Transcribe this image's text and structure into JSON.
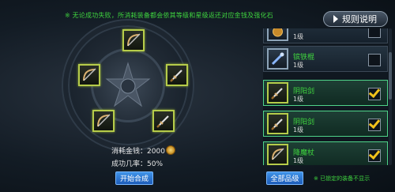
{
  "notice": "※ 无论成功失败，所消耗装备都会依其等级和星级返还对应金钱及强化石",
  "rules_button": {
    "label": "规则说明",
    "icon": "play-arrow-icon"
  },
  "wheel": {
    "slots": [
      {
        "name": "top",
        "icon": "bow-icon"
      },
      {
        "name": "upper-left",
        "icon": "bow-icon"
      },
      {
        "name": "upper-right",
        "icon": "sword-icon"
      },
      {
        "name": "lower-left",
        "icon": "bow-icon"
      },
      {
        "name": "lower-right",
        "icon": "sword-icon"
      }
    ]
  },
  "cost": {
    "label": "消耗金钱：",
    "value": "2000",
    "icon": "gold-coin-icon"
  },
  "success_rate": {
    "label": "成功几率：",
    "value": "50%"
  },
  "start_button": {
    "label": "开始合成"
  },
  "item_list": [
    {
      "name": "",
      "level": "1级",
      "checked": false,
      "icon": "orb-icon",
      "selected": false
    },
    {
      "name": "镔铁棍",
      "level": "1级",
      "checked": false,
      "icon": "staff-icon",
      "selected": false
    },
    {
      "name": "阴阳剑",
      "level": "1级",
      "checked": true,
      "icon": "sword-icon",
      "selected": true
    },
    {
      "name": "阴阳剑",
      "level": "1级",
      "checked": true,
      "icon": "sword-icon",
      "selected": true
    },
    {
      "name": "降魔杖",
      "level": "1级",
      "checked": true,
      "icon": "bow-icon",
      "selected": true
    }
  ],
  "quality_button": {
    "label": "全部品级"
  },
  "locked_note": "※ 已锁定的装备不显示",
  "colors": {
    "notice_green": "#3fd43f",
    "button_blue": "#2a78d6",
    "checkmark_gold": "#f1c21b",
    "slot_border": "#b6cc4a"
  }
}
